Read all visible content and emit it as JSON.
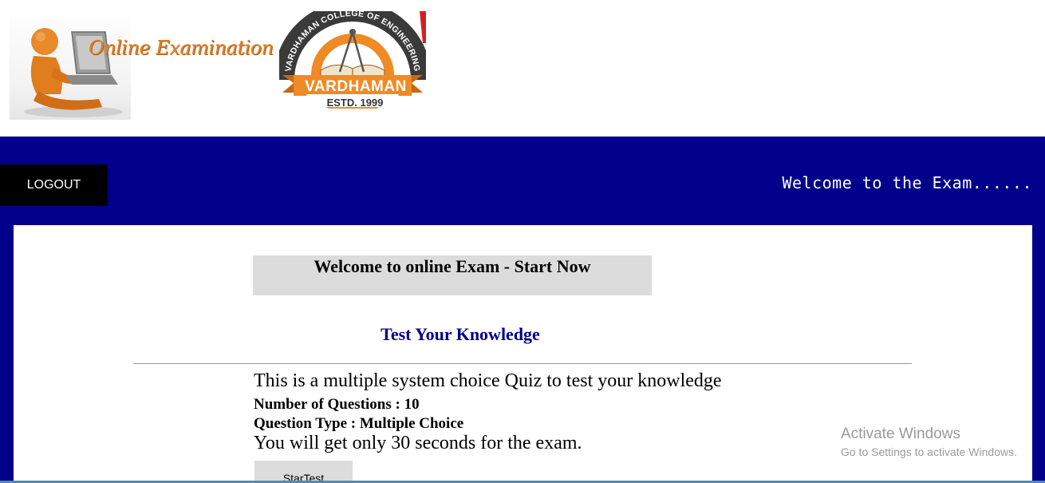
{
  "header": {
    "brand_logo_text": "Online Examination",
    "college_logo": {
      "arc_text": "VARDHAMAN COLLEGE OF ENGINEERING",
      "ribbon_text": "VARDHAMAN",
      "estd_text": "ESTD. 1999"
    }
  },
  "nav": {
    "logout_label": "LOGOUT",
    "welcome_text": "Welcome to the Exam......"
  },
  "main": {
    "start_heading": "Welcome to online Exam - Start Now",
    "subtitle": "Test Your Knowledge",
    "description": "This is a multiple system choice Quiz to test your knowledge",
    "questions_line": "Number of Questions  : 10",
    "type_line": "Question Type : Multiple Choice",
    "time_line": "You will get only 30 seconds for the exam.",
    "start_button_label": "StarTest"
  },
  "watermark": {
    "title": "Activate Windows",
    "subtitle": "Go to Settings to activate Windows."
  },
  "colors": {
    "nav_background": "#00008b",
    "logout_background": "#000000",
    "brand_orange": "#d9822b",
    "subtitle_color": "#00008b"
  }
}
